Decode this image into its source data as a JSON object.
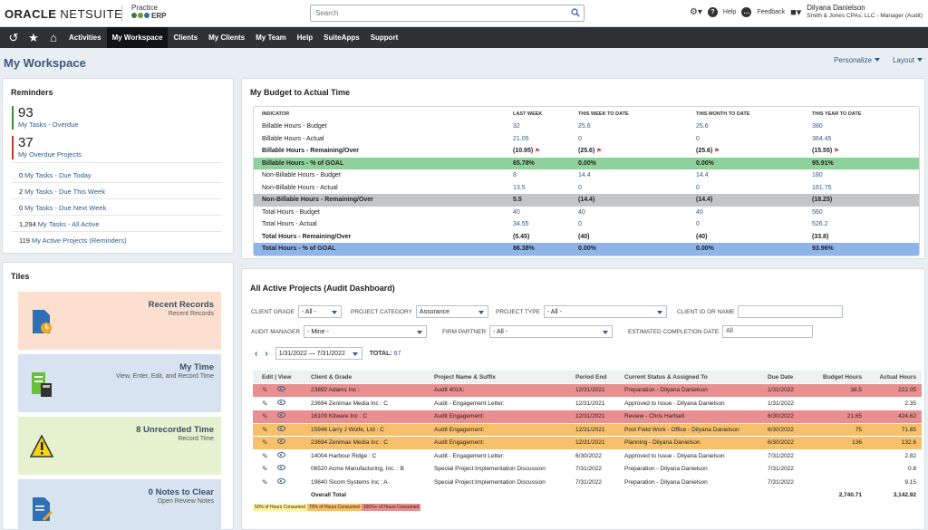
{
  "brand": {
    "oracle": "ORACLE",
    "netsuite": "NETSUITE",
    "practice_top": "Practice",
    "practice_bottom": "ERP"
  },
  "search": {
    "placeholder": "Search"
  },
  "header": {
    "help": "Help",
    "feedback": "Feedback",
    "user_name": "Dilyana Danielson",
    "user_role": "Smith & Jones CPAs, LLC - Manager (Audit)"
  },
  "nav": {
    "items": [
      "Activities",
      "My Workspace",
      "Clients",
      "My Clients",
      "My Team",
      "Help",
      "SuiteApps",
      "Support"
    ],
    "active": "My Workspace"
  },
  "page": {
    "title": "My Workspace",
    "personalize": "Personalize",
    "layout": "Layout"
  },
  "reminders": {
    "title": "Reminders",
    "big": [
      {
        "count": "93",
        "label": "My Tasks - Overdue",
        "color": "#3f8a3f"
      },
      {
        "count": "37",
        "label": "My Overdue Projects",
        "color": "#c0392b"
      }
    ],
    "small": [
      {
        "count": "0",
        "label": "My Tasks - Due Today"
      },
      {
        "count": "2",
        "label": "My Tasks - Due This Week"
      },
      {
        "count": "0",
        "label": "My Tasks - Due Next Week"
      },
      {
        "count": "1,294",
        "label": "My Tasks - All Active"
      },
      {
        "count": "119",
        "label": "My Active Projects (Reminders)"
      }
    ]
  },
  "tiles": {
    "title": "Tiles",
    "items": [
      {
        "title": "Recent Records",
        "sub": "Recent Records",
        "bg": "#fbe0cf"
      },
      {
        "title": "My Time",
        "sub": "View, Enter, Edit, and Record Time",
        "bg": "#d7e3f1"
      },
      {
        "title": "8 Unrecorded Time",
        "sub": "Record Time",
        "bg": "#e6f1cf"
      },
      {
        "title": "0 Notes to Clear",
        "sub": "Open Review Notes",
        "bg": "#d7e3f1"
      }
    ]
  },
  "budget": {
    "title": "My Budget to Actual Time",
    "headers": [
      "INDICATOR",
      "LAST WEEK",
      "THIS WEEK TO DATE",
      "THIS MONTH TO DATE",
      "THIS YEAR TO DATE"
    ],
    "rows": [
      {
        "label": "Billable Hours - Budget",
        "v": [
          "32",
          "25.6",
          "25.6",
          "380"
        ]
      },
      {
        "label": "Billable Hours - Actual",
        "v": [
          "21.05",
          "0",
          "0",
          "364.45"
        ]
      },
      {
        "label": "Billable Hours - Remaining/Over",
        "v": [
          "(10.95)",
          "(25.6)",
          "(25.6)",
          "(15.55)"
        ]
      },
      {
        "label": "Billable Hours - % of GOAL",
        "v": [
          "65.78%",
          "0.00%",
          "0.00%",
          "95.91%"
        ]
      },
      {
        "label": "Non-Billable Hours - Budget",
        "v": [
          "8",
          "14.4",
          "14.4",
          "180"
        ]
      },
      {
        "label": "Non-Billable Hours - Actual",
        "v": [
          "13.5",
          "0",
          "0",
          "161.75"
        ]
      },
      {
        "label": "Non-Billable Hours - Remaining/Over",
        "v": [
          "5.5",
          "(14.4)",
          "(14.4)",
          "(18.25)"
        ]
      },
      {
        "label": "Total Hours - Budget",
        "v": [
          "40",
          "40",
          "40",
          "560"
        ]
      },
      {
        "label": "Total Hours - Actual",
        "v": [
          "34.55",
          "0",
          "0",
          "526.2"
        ]
      },
      {
        "label": "Total Hours - Remaining/Over",
        "v": [
          "(5.45)",
          "(40)",
          "(40)",
          "(33.8)"
        ]
      },
      {
        "label": "Total Hours - % of GOAL",
        "v": [
          "86.38%",
          "0.00%",
          "0.00%",
          "93.96%"
        ]
      }
    ]
  },
  "projects": {
    "title": "All Active Projects (Audit Dashboard)",
    "filters": {
      "client_grade_label": "CLIENT GRADE",
      "client_grade": "- All -",
      "project_category_label": "PROJECT CATEGORY",
      "project_category": "Assurance",
      "project_type_label": "PROJECT TYPE",
      "project_type": "- All -",
      "client_id_label": "CLIENT ID OR NAME",
      "client_id": "",
      "audit_manager_label": "AUDIT MANAGER",
      "audit_manager": "- Mine -",
      "firm_partner_label": "FIRM PARTNER",
      "firm_partner": "- All -",
      "completion_label": "ESTIMATED COMPLETION DATE",
      "completion": "All"
    },
    "date_range": "1/31/2022 — 7/31/2022",
    "total_label": "TOTAL:",
    "total": "67",
    "headers": [
      "Edit | View",
      "Client & Grade",
      "Project Name & Suffix",
      "Period End",
      "Current Status & Assigned To",
      "Due Date",
      "Budget Hours",
      "Actual Hours"
    ],
    "rows": [
      {
        "client": "23892 Adams Inc :",
        "project": "Audit 401K:",
        "period": "12/31/2021",
        "status": "Preparation - Dilyana Danielson",
        "due": "1/31/2022",
        "budget": "38.5",
        "actual": "222.05",
        "hl": "red"
      },
      {
        "client": "23694 Zenimax Media Inc : C",
        "project": "Audit - Engagement Letter:",
        "period": "12/31/2021",
        "status": "Approved to Issue - Dilyana Danielson",
        "due": "1/31/2022",
        "budget": "",
        "actual": "2.35",
        "hl": ""
      },
      {
        "client": "16109 Kitware Inc : C",
        "project": "Audit Engagement:",
        "period": "12/31/2021",
        "status": "Review - Chris Hartsell",
        "due": "6/30/2022",
        "budget": "21.65",
        "actual": "424.62",
        "hl": "red"
      },
      {
        "client": "15946 Larry J Wolfe, Ltd : C",
        "project": "Audit Engagement:",
        "period": "12/31/2021",
        "status": "Post Field Work - Office - Dilyana Danielson",
        "due": "6/30/2022",
        "budget": "75",
        "actual": "71.65",
        "hl": "org"
      },
      {
        "client": "23694 Zenimax Media Inc : C",
        "project": "Audit Engagement:",
        "period": "12/31/2021",
        "status": "Planning - Dilyana Danielson",
        "due": "6/30/2022",
        "budget": "136",
        "actual": "132.6",
        "hl": "org"
      },
      {
        "client": "14004 Harbour Ridge : C",
        "project": "Audit - Engagement Letter:",
        "period": "6/30/2022",
        "status": "Approved to Issue - Dilyana Danielson",
        "due": "7/31/2022",
        "budget": "",
        "actual": "2.82",
        "hl": ""
      },
      {
        "client": "06520 Acme Manufacturing, Inc. : B",
        "project": "Special Project:Implementation Discussion",
        "period": "7/31/2022",
        "status": "Preparation - Dilyana Danielson",
        "due": "7/31/2022",
        "budget": "",
        "actual": "0.8",
        "hl": ""
      },
      {
        "client": "19840 Sicom Systems Inc : A",
        "project": "Special Project:Implementation Discussion",
        "period": "7/31/2022",
        "status": "Preparation - Dilyana Danielson",
        "due": "7/31/2022",
        "budget": "",
        "actual": "9.15",
        "hl": ""
      }
    ],
    "overall": {
      "label": "Overall Total",
      "budget": "2,740.71",
      "actual": "3,142.92"
    },
    "legend": [
      {
        "text": "50% of Hours Consumed",
        "color": "#fff2a0"
      },
      {
        "text": "70% of Hours Consumed",
        "color": "#f7c06a"
      },
      {
        "text": "100%+ of Hours Consumed",
        "color": "#e98f8f"
      }
    ]
  }
}
